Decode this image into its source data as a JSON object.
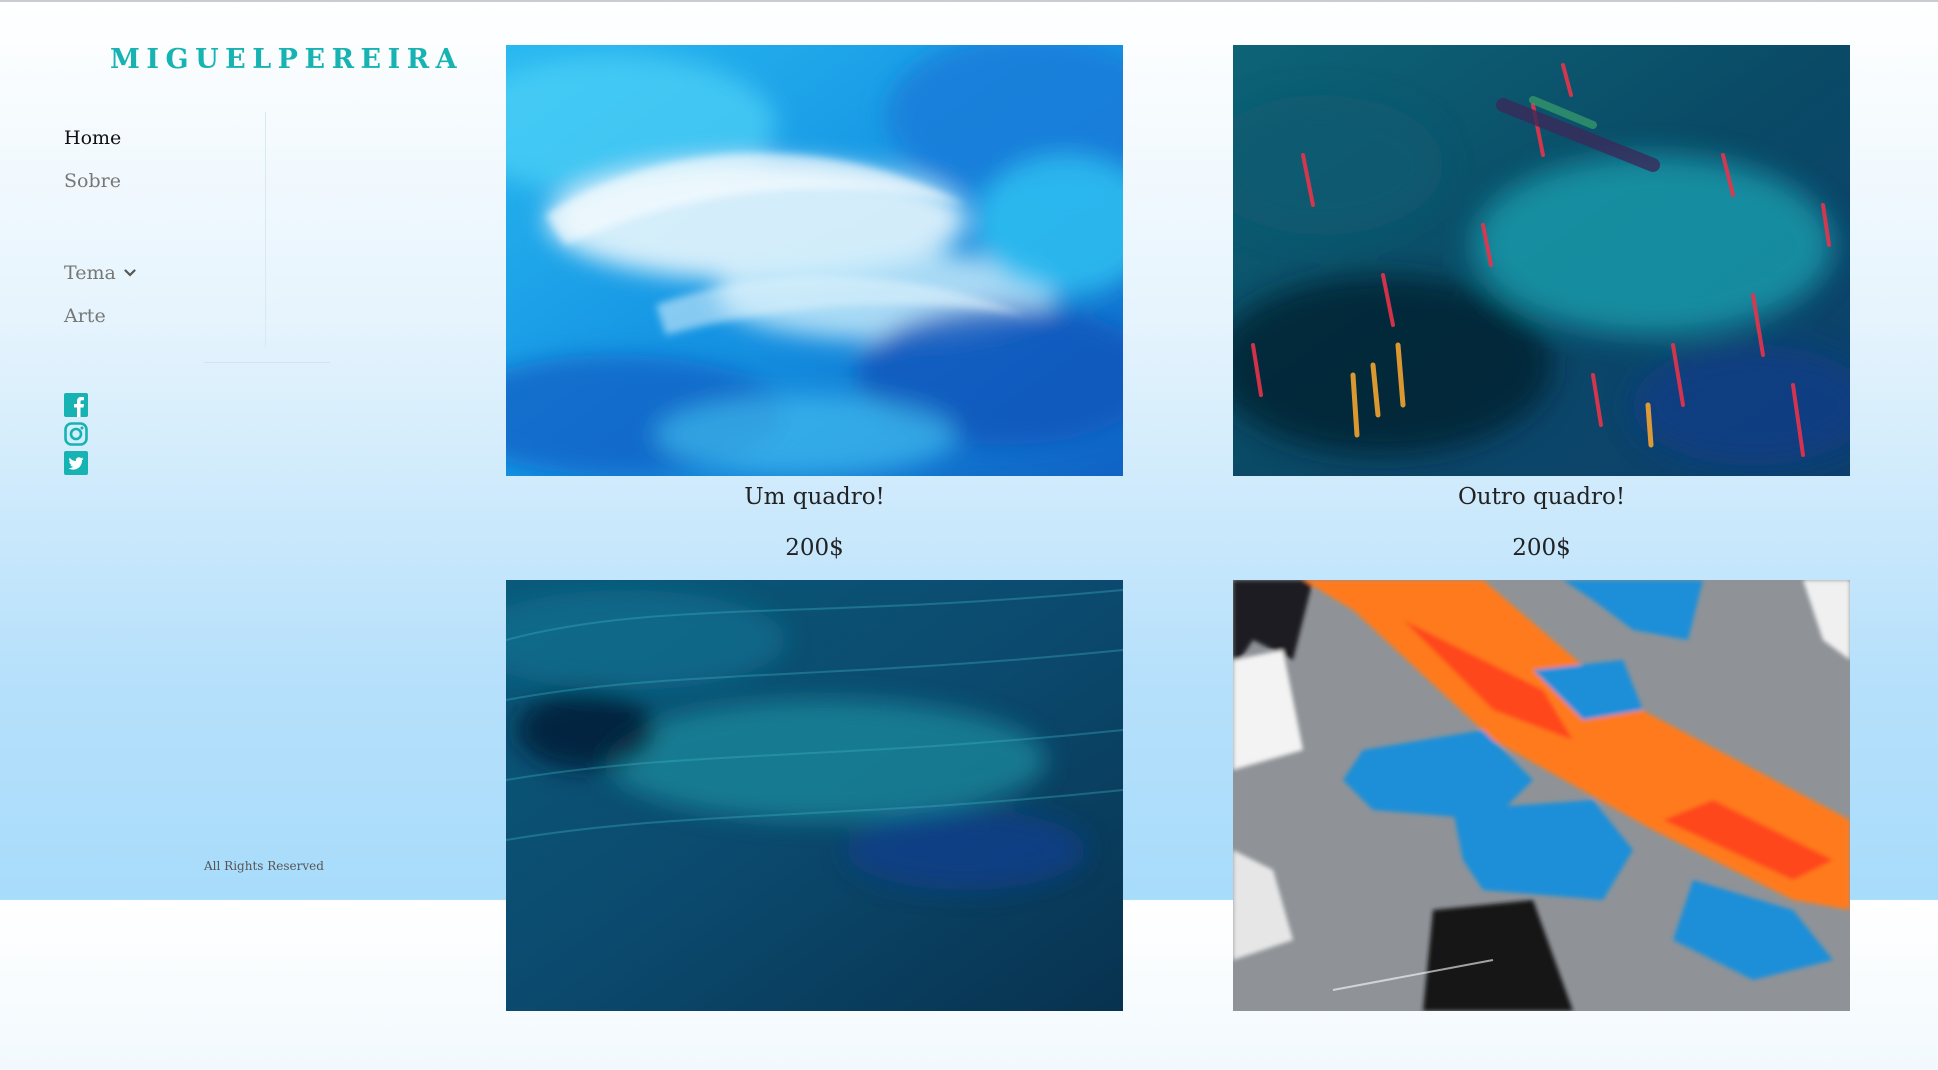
{
  "brand": "MIGUELPEREIRA",
  "nav": {
    "home": "Home",
    "sobre": "Sobre",
    "tema": "Tema",
    "arte": "Arte"
  },
  "social": [
    "facebook-icon",
    "instagram-icon",
    "twitter-icon"
  ],
  "footer": "All Rights Reserved",
  "colors": {
    "brand": "#17b3b3",
    "social": "#17b3b3"
  },
  "gallery": [
    {
      "title": "Um quadro!",
      "price": "200$"
    },
    {
      "title": "Outro quadro!",
      "price": "200$"
    },
    {
      "title": "",
      "price": ""
    },
    {
      "title": "",
      "price": ""
    }
  ]
}
